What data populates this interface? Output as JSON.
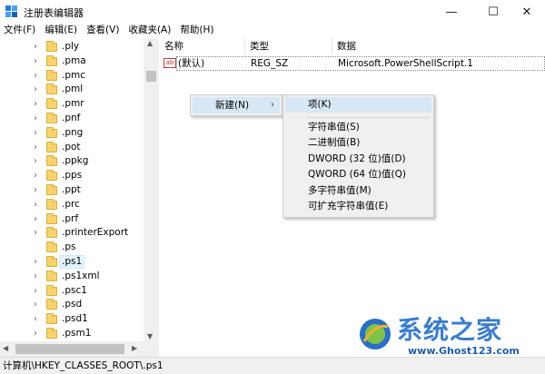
{
  "window": {
    "title": "注册表编辑器",
    "min_glyph": "—",
    "max_glyph": "☐",
    "close_glyph": "✕"
  },
  "menubar": {
    "items": [
      "文件(F)",
      "编辑(E)",
      "查看(V)",
      "收藏夹(A)",
      "帮助(H)"
    ]
  },
  "tree": {
    "items": [
      {
        "label": ".ply",
        "expandable": true
      },
      {
        "label": ".pma",
        "expandable": true
      },
      {
        "label": ".pmc",
        "expandable": true
      },
      {
        "label": ".pml",
        "expandable": true
      },
      {
        "label": ".pmr",
        "expandable": true
      },
      {
        "label": ".pnf",
        "expandable": true
      },
      {
        "label": ".png",
        "expandable": true
      },
      {
        "label": ".pot",
        "expandable": true
      },
      {
        "label": ".ppkg",
        "expandable": true
      },
      {
        "label": ".pps",
        "expandable": true
      },
      {
        "label": ".ppt",
        "expandable": true
      },
      {
        "label": ".prc",
        "expandable": true
      },
      {
        "label": ".prf",
        "expandable": true
      },
      {
        "label": ".printerExport",
        "expandable": true
      },
      {
        "label": ".ps",
        "expandable": false
      },
      {
        "label": ".ps1",
        "expandable": true,
        "selected": true
      },
      {
        "label": ".ps1xml",
        "expandable": true
      },
      {
        "label": ".psc1",
        "expandable": true
      },
      {
        "label": ".psd",
        "expandable": true
      },
      {
        "label": ".psd1",
        "expandable": true
      },
      {
        "label": ".psm1",
        "expandable": true
      }
    ]
  },
  "values_pane": {
    "columns": {
      "name": "名称",
      "type": "类型",
      "data": "数据"
    },
    "rows": [
      {
        "icon": "ab",
        "name": "(默认)",
        "type": "REG_SZ",
        "data": "Microsoft.PowerShellScript.1"
      }
    ]
  },
  "context_menu": {
    "new_label": "新建(N)",
    "new_arrow": "›",
    "submenu": {
      "key_label": "项(K)",
      "items": [
        "字符串值(S)",
        "二进制值(B)",
        "DWORD (32 位)值(D)",
        "QWORD (64 位)值(Q)",
        "多字符串值(M)",
        "可扩充字符串值(E)"
      ]
    }
  },
  "statusbar": {
    "path": "计算机\\HKEY_CLASSES_ROOT\\.ps1"
  },
  "watermark": {
    "title": "系统之家",
    "url": "www.Ghost123.com"
  },
  "colors": {
    "selection": "#d7e7f6",
    "folder": "#f7d36d",
    "watermark_blue": "#3a7dcc"
  }
}
